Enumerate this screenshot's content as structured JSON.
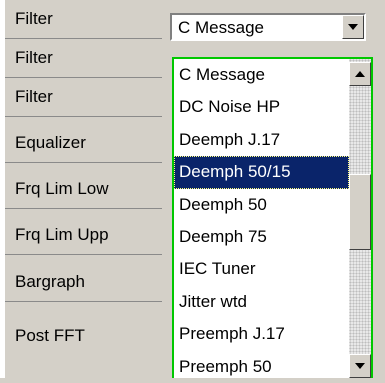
{
  "labels": [
    "Filter",
    "Filter",
    "Filter",
    "Equalizer",
    "Frq Lim Low",
    "Frq Lim Upp",
    "Bargraph",
    "Post FFT"
  ],
  "combo": {
    "value": "C Message",
    "button_icon": "chevron-down-icon"
  },
  "dropdown": {
    "options": [
      "C Message",
      "DC Noise HP",
      "Deemph J.17",
      "Deemph 50/15",
      "Deemph 50",
      "Deemph 75",
      "IEC Tuner",
      "Jitter wtd",
      "Preemph J.17",
      "Preemph 50"
    ],
    "selected": "Deemph 50/15",
    "border_color": "#00c800",
    "highlight_color": "#0a246a"
  }
}
